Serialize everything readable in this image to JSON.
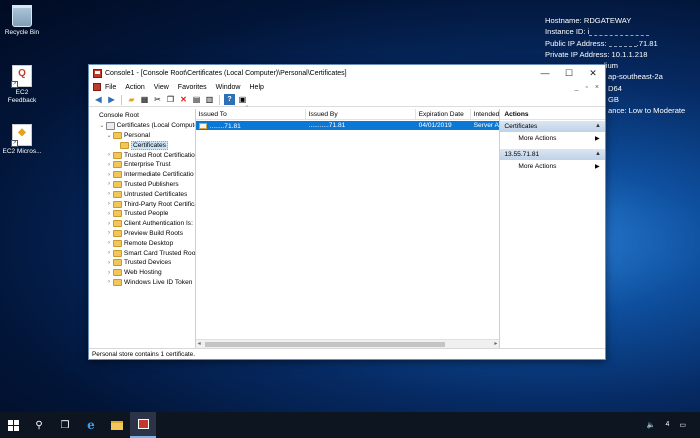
{
  "desktop": {
    "icons": [
      {
        "label": "Recycle Bin"
      },
      {
        "label": "EC2 Feedback",
        "glyph": "Q"
      },
      {
        "label": "EC2 Micros...",
        "glyph": "◆"
      }
    ],
    "sysinfo": {
      "hostname": "Hostname: RDGATEWAY",
      "instance_id": "Instance ID: i",
      "public_ip_label": "Public IP Address:",
      "public_ip_tail": ".71.81",
      "private_ip": "Private IP Address: 10.1.1.218",
      "instance_size_tail": "medium",
      "zone_tail": "ap-southeast-2a",
      "arch_tail": "D64",
      "memory_tail": "GB",
      "network_tail": "ance: Low to Moderate"
    }
  },
  "window": {
    "title": "Console1 - [Console Root\\Certificates (Local Computer)\\Personal\\Certificates]",
    "controls": {
      "minimize": "—",
      "maximize": "☐",
      "close": "✕"
    },
    "menu": [
      "File",
      "Action",
      "View",
      "Favorites",
      "Window",
      "Help"
    ],
    "menu_right": {
      "minimize": "_",
      "restore": "▫",
      "close": "×"
    },
    "tree": [
      {
        "label": "Console Root",
        "level": 0,
        "exp": "",
        "icon": "none"
      },
      {
        "label": "Certificates (Local Compute",
        "level": 1,
        "exp": "⌄",
        "icon": "cert"
      },
      {
        "label": "Personal",
        "level": 2,
        "exp": "⌄",
        "icon": "folder"
      },
      {
        "label": "Certificates",
        "level": 3,
        "exp": "",
        "icon": "folder",
        "selected": true
      },
      {
        "label": "Trusted Root Certificatio",
        "level": 2,
        "exp": "›",
        "icon": "folder"
      },
      {
        "label": "Enterprise Trust",
        "level": 2,
        "exp": "›",
        "icon": "folder"
      },
      {
        "label": "Intermediate Certificatio",
        "level": 2,
        "exp": "›",
        "icon": "folder"
      },
      {
        "label": "Trusted Publishers",
        "level": 2,
        "exp": "›",
        "icon": "folder"
      },
      {
        "label": "Untrusted Certificates",
        "level": 2,
        "exp": "›",
        "icon": "folder"
      },
      {
        "label": "Third-Party Root Certifica",
        "level": 2,
        "exp": "›",
        "icon": "folder"
      },
      {
        "label": "Trusted People",
        "level": 2,
        "exp": "›",
        "icon": "folder"
      },
      {
        "label": "Client Authentication Is:",
        "level": 2,
        "exp": "›",
        "icon": "folder"
      },
      {
        "label": "Preview Build Roots",
        "level": 2,
        "exp": "›",
        "icon": "folder"
      },
      {
        "label": "Remote Desktop",
        "level": 2,
        "exp": "›",
        "icon": "folder"
      },
      {
        "label": "Smart Card Trusted Roo",
        "level": 2,
        "exp": "›",
        "icon": "folder"
      },
      {
        "label": "Trusted Devices",
        "level": 2,
        "exp": "›",
        "icon": "folder"
      },
      {
        "label": "Web Hosting",
        "level": 2,
        "exp": "›",
        "icon": "folder"
      },
      {
        "label": "Windows Live ID Token",
        "level": 2,
        "exp": "›",
        "icon": "folder"
      }
    ],
    "columns": [
      "Issued To",
      "Issued By",
      "Expiration Date",
      "Intended"
    ],
    "rows": [
      {
        "issued_to": "........71.81",
        "issued_by": "...........71.81",
        "expiration": "04/01/2019",
        "intended": "Server A"
      }
    ],
    "actions": {
      "header": "Actions",
      "sections": [
        {
          "title": "Certificates",
          "items": [
            "More Actions"
          ]
        },
        {
          "title": "13.55.71.81",
          "items": [
            "More Actions"
          ]
        }
      ]
    },
    "status": "Personal store contains 1 certificate."
  },
  "taskbar": {
    "tray_volume": "🔈",
    "tray_lang": "4"
  },
  "colors": {
    "selection": "#0c78d6",
    "action_section": "#c9d9ea",
    "taskbar": "#0d1520"
  }
}
